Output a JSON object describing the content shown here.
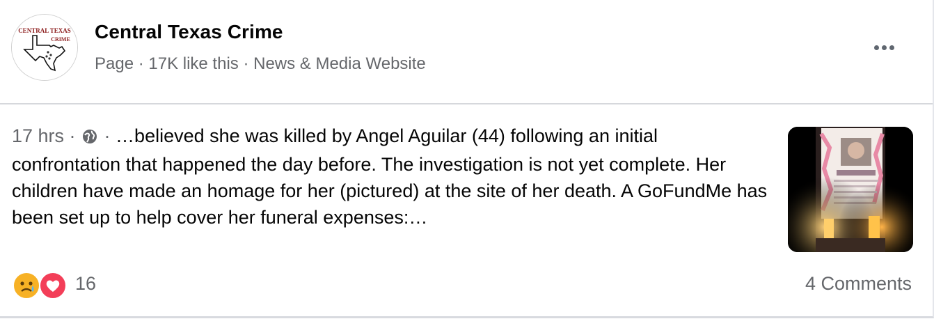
{
  "page": {
    "name": "Central Texas Crime",
    "meta": "Page · 17K like this · News & Media Website",
    "logo_text": [
      "CENTRAL TEXAS",
      "CRIME"
    ]
  },
  "post": {
    "timestamp": "17 hrs",
    "separator": "·",
    "visibility_icon": "globe-icon",
    "text": "…believed she was killed by Angel Aguilar (44) following an initial confrontation that happened the day before. The investigation is not yet complete. Her children have made an homage for her (pictured) at the site of her death. A GoFundMe has been set up to help cover her funeral expenses:…"
  },
  "footer": {
    "reactions": [
      "sad-reaction-icon",
      "love-reaction-icon"
    ],
    "reaction_count": "16",
    "comments": "4 Comments"
  },
  "colors": {
    "text": "#050505",
    "secondary": "#65676b",
    "divider": "#d6d8dc",
    "logo_red": "#8b1a1a"
  }
}
